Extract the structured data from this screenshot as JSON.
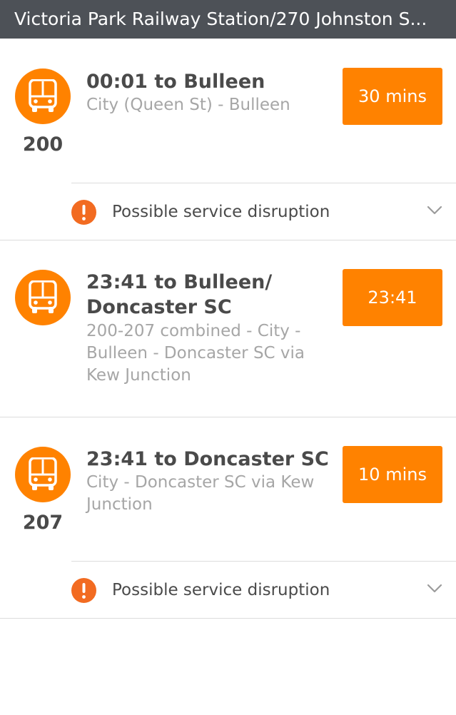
{
  "header": {
    "title": "Victoria Park Railway Station/270 Johnston S..."
  },
  "departures": [
    {
      "route_number": "200",
      "title": "00:01 to Bulleen",
      "subtitle": "City (Queen St) - Bulleen",
      "time_label": "30 mins",
      "disruption_label": "Possible service disruption"
    },
    {
      "route_number": "",
      "title": "23:41 to Bulleen/ Doncaster SC",
      "subtitle": "200-207 combined - City - Bulleen - Doncaster SC via Kew Junction",
      "time_label": "23:41"
    },
    {
      "route_number": "207",
      "title": "23:41 to Doncaster SC",
      "subtitle": "City - Doncaster SC via Kew Junction",
      "time_label": "10 mins",
      "disruption_label": "Possible service disruption"
    }
  ],
  "icons": {
    "route": "bus-icon",
    "alert": "exclamation-icon",
    "expand": "chevron-down-icon"
  },
  "colors": {
    "header_bg": "#4d5157",
    "accent_orange": "#ff8200",
    "alert_orange": "#f26b21",
    "title_text": "#4a4a4a",
    "subtitle_text": "#a6a6a6",
    "divider": "#dcdcdc"
  }
}
